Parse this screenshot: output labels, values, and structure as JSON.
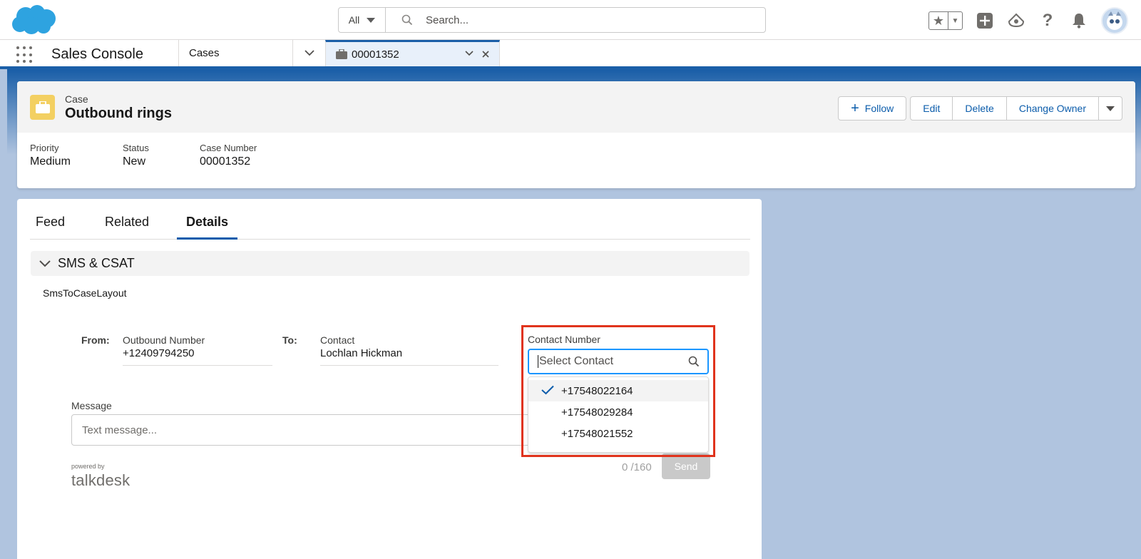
{
  "header": {
    "search_scope": "All",
    "search_placeholder": "Search..."
  },
  "nav": {
    "app_name": "Sales Console",
    "object_tab": "Cases",
    "record_tab": "00001352"
  },
  "record": {
    "object_type": "Case",
    "title": "Outbound rings",
    "actions": {
      "follow": "Follow",
      "edit": "Edit",
      "delete": "Delete",
      "change_owner": "Change Owner"
    },
    "fields": {
      "priority_label": "Priority",
      "priority_value": "Medium",
      "status_label": "Status",
      "status_value": "New",
      "case_number_label": "Case Number",
      "case_number_value": "00001352"
    }
  },
  "tabs": {
    "feed": "Feed",
    "related": "Related",
    "details": "Details"
  },
  "section": {
    "title": "SMS & CSAT",
    "layout_name": "SmsToCaseLayout"
  },
  "sms": {
    "from_label": "From:",
    "outbound_label": "Outbound Number",
    "outbound_value": "+12409794250",
    "to_label": "To:",
    "contact_label": "Contact",
    "contact_value": "Lochlan Hickman",
    "contact_number_label": "Contact Number",
    "contact_number_placeholder": "Select Contact",
    "contact_numbers": [
      "+17548022164",
      "+17548029284",
      "+17548021552"
    ],
    "message_label": "Message",
    "message_placeholder": "Text message...",
    "powered_by": "powered by",
    "brand": "talkdesk",
    "counter": "0 /160",
    "send": "Send"
  },
  "colors": {
    "brand_blue": "#1b5fa8",
    "link_blue": "#0b5cab",
    "focus_blue": "#1b96ff",
    "case_icon": "#f3d062",
    "highlight_red": "#e0331c"
  }
}
